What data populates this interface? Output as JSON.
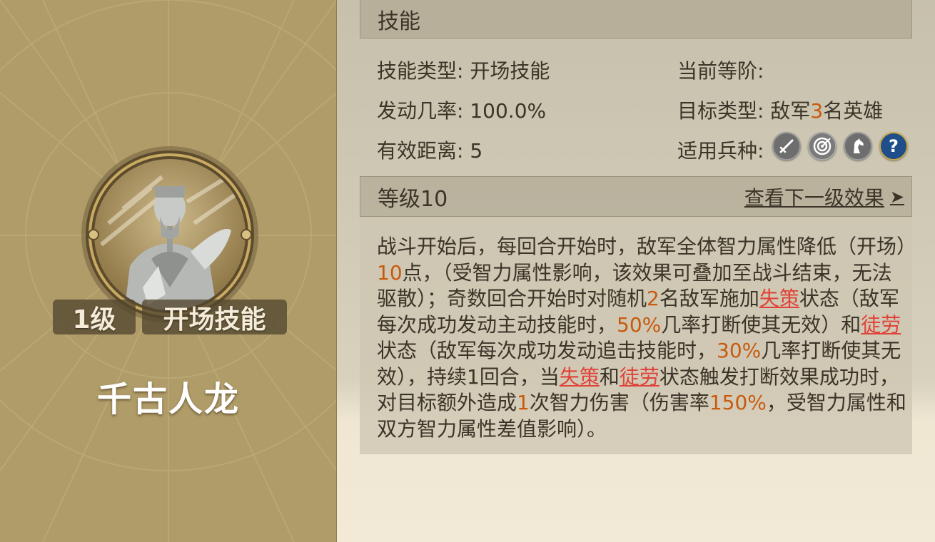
{
  "card": {
    "level": "1级",
    "skill_type": "开场技能",
    "name": "千古人龙"
  },
  "skill_section": {
    "header": "技能",
    "type_label": "技能类型:",
    "type_value": "开场技能",
    "rank_label": "当前等阶:",
    "rank_value": "",
    "rate_label": "发动几率:",
    "rate_value": "100.0%",
    "target_label": "目标类型:",
    "target_prefix": "敌军",
    "target_count": "3",
    "target_suffix": "名英雄",
    "range_label": "有效距离:",
    "range_value": "5",
    "troop_label": "适用兵种:",
    "troop_icons": [
      "sword-icon",
      "archery-target-icon",
      "horse-icon",
      "question-mark-icon"
    ]
  },
  "level_section": {
    "header": "等级10",
    "next_link": "查看下一级效果",
    "next_arrow": "➤"
  },
  "description": {
    "t1": "战斗开始后，每回合开始时，敌军全体智力属性降低（开场）",
    "n1": "10",
    "t2": "点，（受智力属性影响，该效果可叠加至战斗结束，无法驱散）；奇数回合开始时对随机",
    "n2": "2",
    "t3": "名敌军施加",
    "k1": "失策",
    "t4": "状态（敌军每次成功发动主动技能时，",
    "n3": "50%",
    "t5": "几率打断使其无效）和",
    "k2": "徒劳",
    "t6": "状态（敌军每次成功发动追击技能时，",
    "n4": "30%",
    "t7": "几率打断使其无效），持续1回合，当",
    "k3": "失策",
    "t8": "和",
    "k4": "徒劳",
    "t9": "状态触发打断效果成功时，对目标额外造成",
    "n5": "1",
    "t10": "次智力伤害（伤害率",
    "n6": "150%",
    "t11": "，受智力属性和双方智力属性差值影响）。"
  },
  "colors": {
    "highlight_number": "#c85a0e",
    "keyword": "#e0433a",
    "card_background": "#b09c69"
  }
}
